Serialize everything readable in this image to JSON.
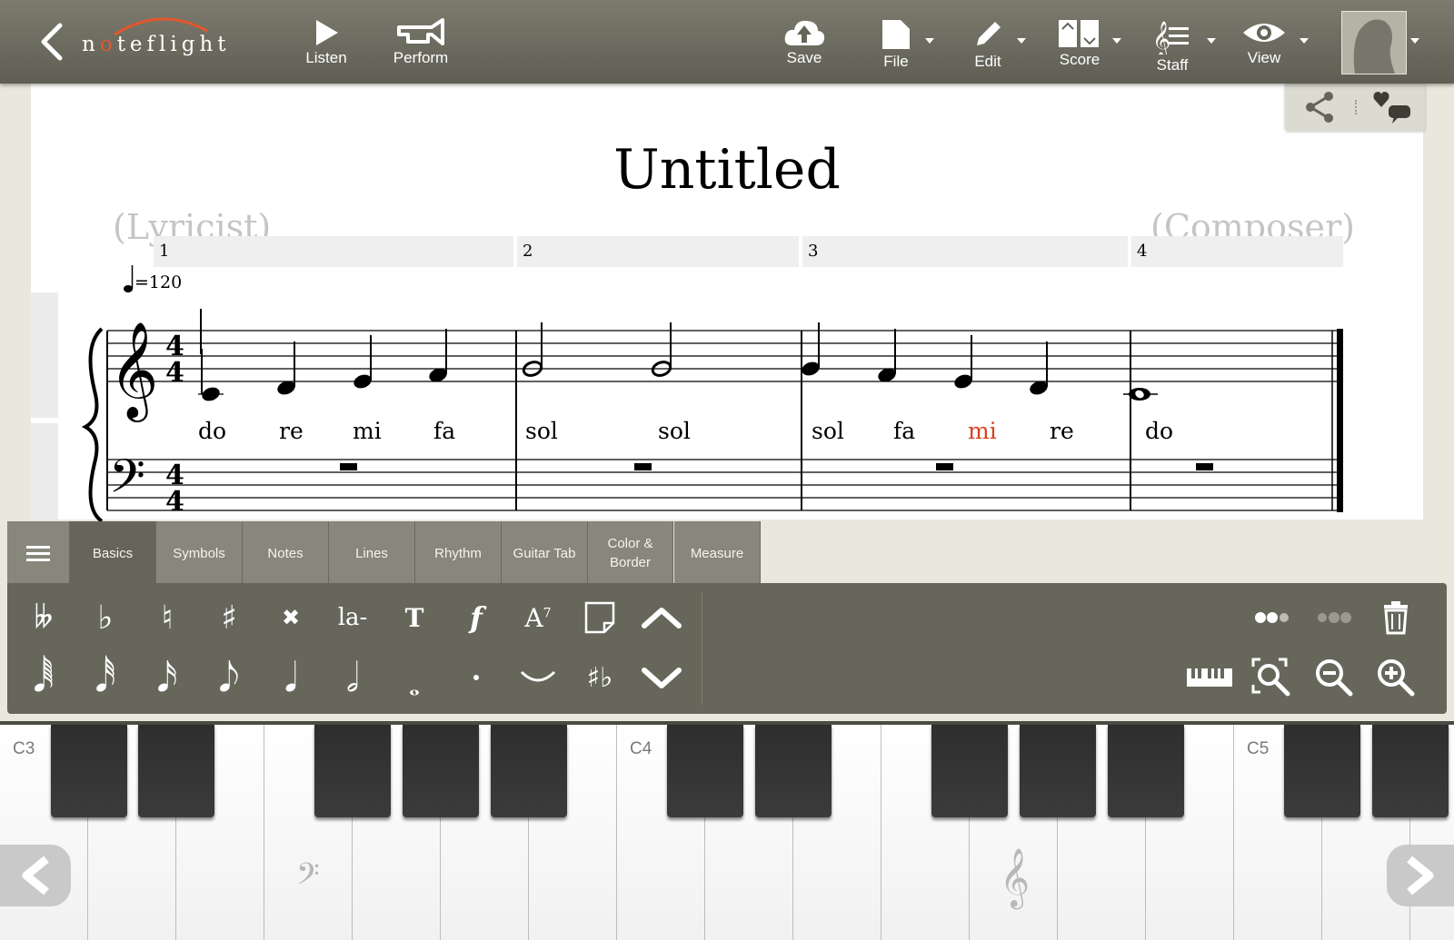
{
  "app": {
    "logo_text_1": "n",
    "logo_text_o": "o",
    "logo_text_2": "teflight"
  },
  "toolbar": {
    "listen": "Listen",
    "perform": "Perform",
    "save": "Save",
    "file": "File",
    "edit": "Edit",
    "score": "Score",
    "staff": "Staff",
    "view": "View"
  },
  "score": {
    "title": "Untitled",
    "lyricist": "(Lyricist)",
    "composer": "(Composer)",
    "tempo": "=120",
    "measures": [
      "1",
      "2",
      "3",
      "4"
    ],
    "lyrics": [
      "do",
      "re",
      "mi",
      "fa",
      "sol",
      "sol",
      "sol",
      "fa",
      "mi",
      "re",
      "do"
    ],
    "highlight_color": "#d8401e"
  },
  "palette": {
    "tabs": [
      "Basics",
      "Symbols",
      "Notes",
      "Lines",
      "Rhythm",
      "Guitar Tab",
      "Color & Border",
      "Measure"
    ],
    "active_tab": "Basics",
    "lyric_tool": "la-",
    "text_tool": "T",
    "dynamic_tool": "f",
    "chord_tool": "A",
    "chord_sup": "7"
  },
  "keyboard": {
    "labels": [
      "C3",
      "C4",
      "C5"
    ]
  }
}
